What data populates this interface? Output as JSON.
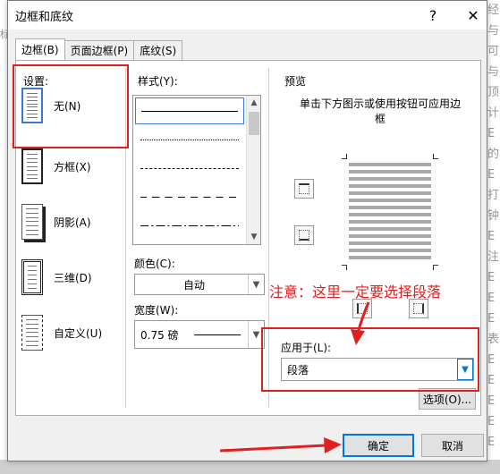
{
  "window": {
    "title": "边框和底纹",
    "help": "?",
    "close": "✕"
  },
  "tabs": [
    {
      "label": "边框(B)"
    },
    {
      "label": "页面边框(P)"
    },
    {
      "label": "底纹(S)"
    }
  ],
  "settings": {
    "label": "设置:",
    "items": [
      {
        "label": "无(N)"
      },
      {
        "label": "方框(X)"
      },
      {
        "label": "阴影(A)"
      },
      {
        "label": "三维(D)"
      },
      {
        "label": "自定义(U)"
      }
    ]
  },
  "style": {
    "label": "样式(Y):"
  },
  "color": {
    "label": "颜色(C):",
    "value": "自动"
  },
  "width": {
    "label": "宽度(W):",
    "value": "0.75 磅"
  },
  "preview": {
    "label": "预览",
    "hint": "单击下方图示或使用按钮可应用边框"
  },
  "apply": {
    "label": "应用于(L):",
    "value": "段落"
  },
  "buttons": {
    "options": "选项(O)...",
    "ok": "确定",
    "cancel": "取消"
  },
  "annotation": "注意：这里一定要选择段落",
  "colors": {
    "annotation": "#e02020",
    "focus": "#0078d7"
  }
}
